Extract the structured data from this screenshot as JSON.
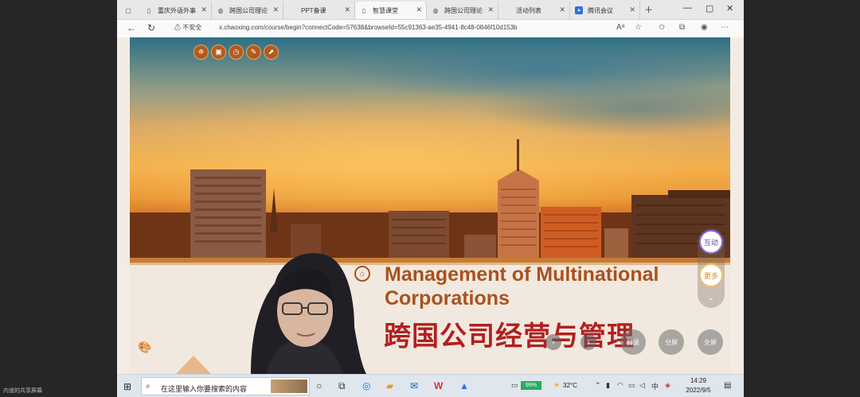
{
  "caption": "内道的共享屏幕",
  "browser": {
    "tabs": [
      {
        "label": "重庆外语外事",
        "icon": "document-icon"
      },
      {
        "label": "跨国公司理论",
        "icon": "globe-icon"
      },
      {
        "label": "PPT备课",
        "icon": ""
      },
      {
        "label": "智慧课堂",
        "icon": "document-icon"
      },
      {
        "label": "跨国公司理论",
        "icon": "globe-icon"
      },
      {
        "label": "活动列表",
        "icon": ""
      },
      {
        "label": "腾讯会议",
        "icon": "tencent-meeting-icon"
      }
    ],
    "security_label": "不安全",
    "url": "x.chaoxing.com/course/begin?connectCode=57638&browseId=55c91363-ae35-4941-8c48-0846f10d153b"
  },
  "slide": {
    "title_en": "Management of Multinational Corporations",
    "title_cn": "跨国公司经营与管理"
  },
  "overlay": {
    "interact_label": "互动",
    "more_label": "更多",
    "toc_label": "目录",
    "split_label": "分屏",
    "fullscreen_label": "全屏"
  },
  "taskbar": {
    "search_placeholder": "在这里输入你要搜索的内容",
    "battery": "99%",
    "temperature": "32°C",
    "time": "14:29",
    "date": "2022/9/5"
  }
}
